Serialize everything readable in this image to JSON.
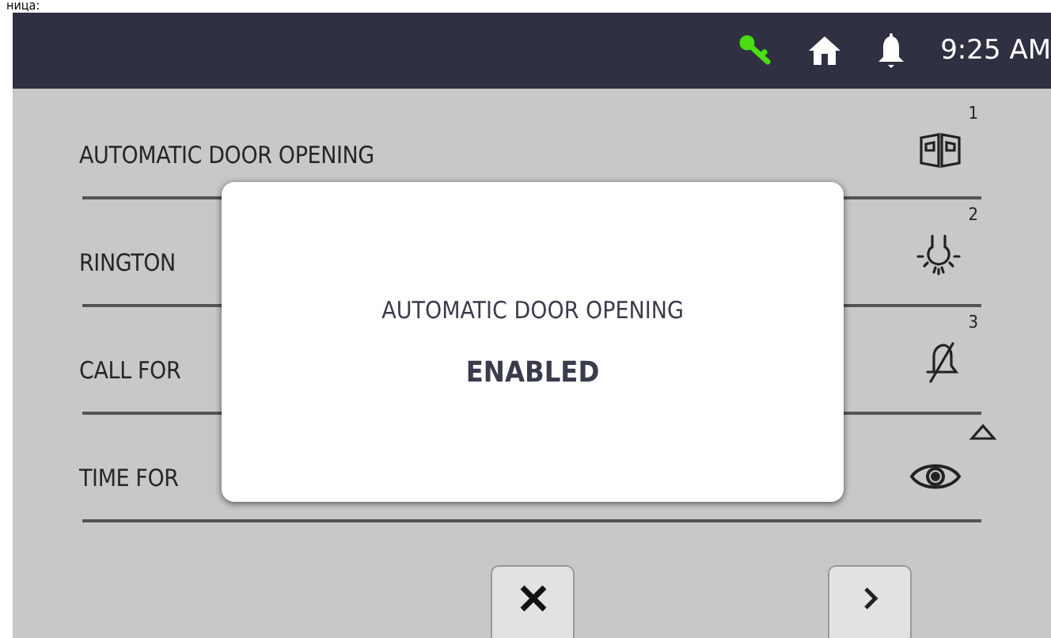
{
  "caption": "ница:",
  "status_bar": {
    "indicators": [
      {
        "kind": "key"
      },
      {
        "kind": "home"
      },
      {
        "kind": "bell"
      }
    ],
    "time": "9:25 AM"
  },
  "rows": [
    {
      "label": "AUTOMATIC DOOR OPENING",
      "kind": "door",
      "badge": "1"
    },
    {
      "label": "RINGTON",
      "kind": "bulb",
      "badge": "2"
    },
    {
      "label": "CALL FOR",
      "kind": "mute",
      "badge": "3"
    },
    {
      "label": "TIME FOR",
      "kind": "eye"
    }
  ],
  "dialog": {
    "title": "AUTOMATIC DOOR OPENING",
    "status": "ENABLED"
  },
  "buttons": [
    {
      "kind": "close"
    },
    {
      "kind": "next"
    }
  ]
}
